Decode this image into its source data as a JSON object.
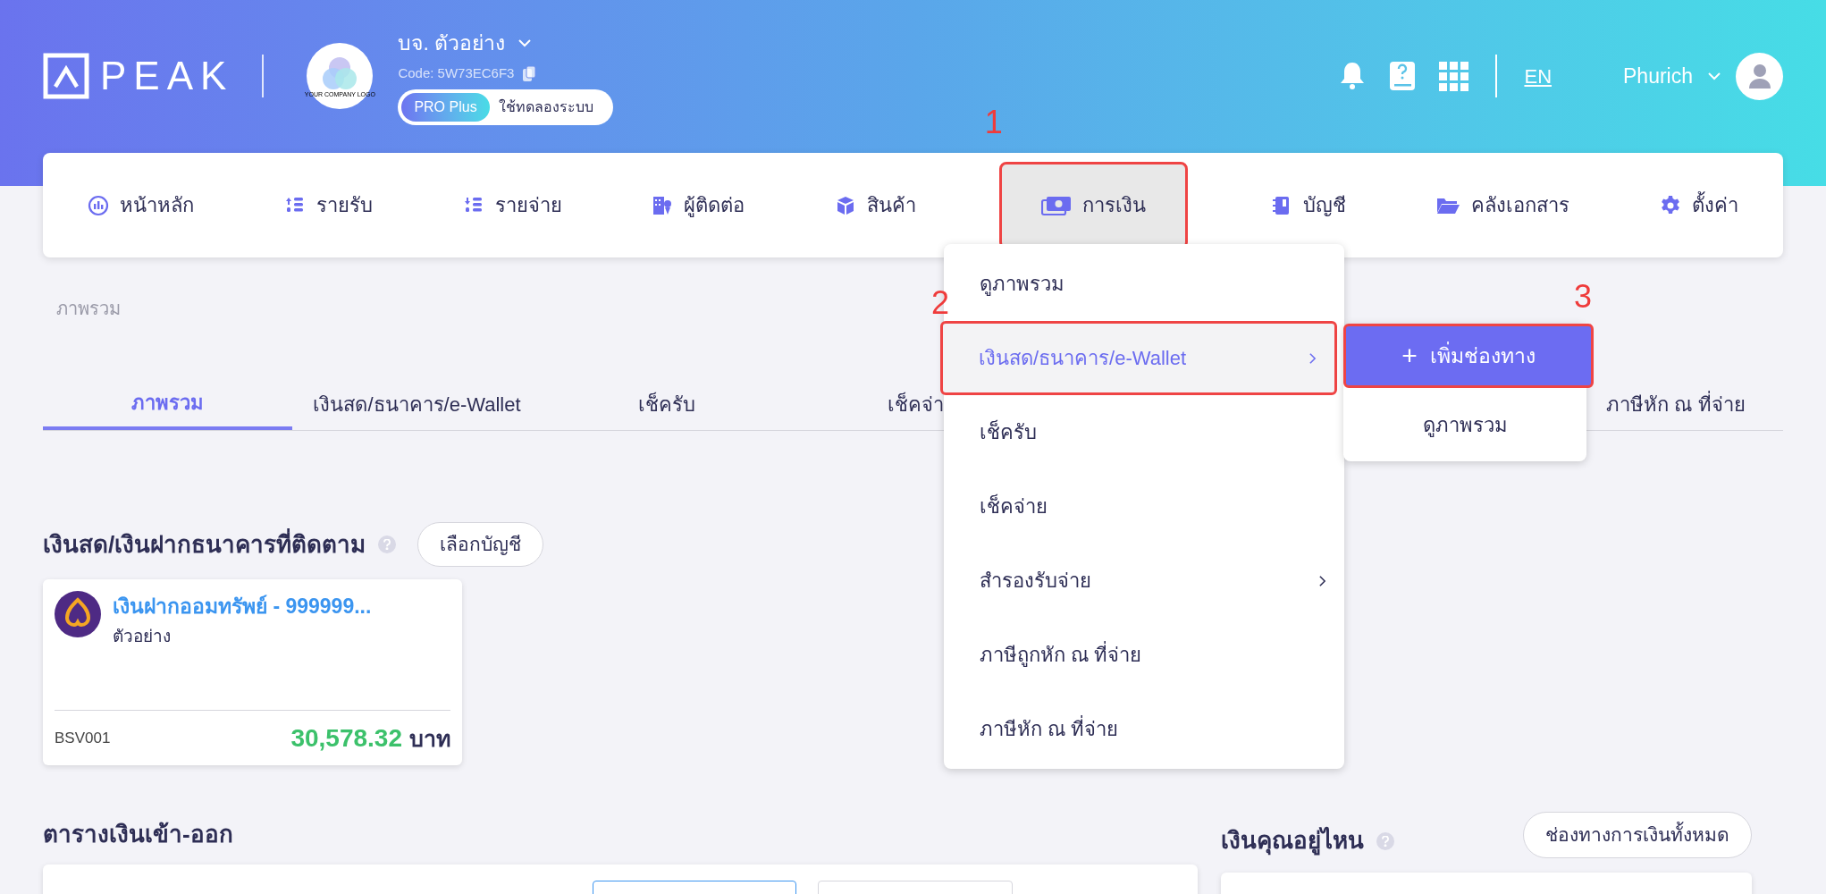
{
  "header": {
    "logo_text": "PEAK",
    "company_logo_text": "YOUR COMPANY LOGO",
    "company_name": "บจ. ตัวอย่าง",
    "company_code": "Code: 5W73EC6F3",
    "plan_badge": "PRO Plus",
    "plan_note": "ใช้ทดลองระบบ",
    "language": "EN",
    "user_name": "Phurich"
  },
  "nav": {
    "items": [
      {
        "label": "หน้าหลัก",
        "selected": false
      },
      {
        "label": "รายรับ",
        "selected": false
      },
      {
        "label": "รายจ่าย",
        "selected": false
      },
      {
        "label": "ผู้ติดต่อ",
        "selected": false
      },
      {
        "label": "สินค้า",
        "selected": false
      },
      {
        "label": "การเงิน",
        "selected": true,
        "callout": "1"
      },
      {
        "label": "บัญชี",
        "selected": false
      },
      {
        "label": "คลังเอกสาร",
        "selected": false
      },
      {
        "label": "ตั้งค่า",
        "selected": false
      }
    ]
  },
  "breadcrumb": "ภาพรวม",
  "tabs": [
    {
      "label": "ภาพรวม",
      "selected": true
    },
    {
      "label": "เงินสด/ธนาคาร/e-Wallet",
      "selected": false
    },
    {
      "label": "เช็ครับ",
      "selected": false
    },
    {
      "label": "เช็คจ่า",
      "selected": false
    },
    {
      "label": "ภาษีหัก ณ ที่จ่าย",
      "selected": false
    }
  ],
  "dropdown": {
    "items": [
      {
        "label": "ดูภาพรวม",
        "selected": false,
        "has_submenu": false
      },
      {
        "label": "เงินสด/ธนาคาร/e-Wallet",
        "selected": true,
        "has_submenu": true,
        "callout": "2"
      },
      {
        "label": "เช็ครับ",
        "selected": false,
        "has_submenu": false
      },
      {
        "label": "เช็คจ่าย",
        "selected": false,
        "has_submenu": false
      },
      {
        "label": "สำรองรับจ่าย",
        "selected": false,
        "has_submenu": true
      },
      {
        "label": "ภาษีถูกหัก ณ ที่จ่าย",
        "selected": false,
        "has_submenu": false
      },
      {
        "label": "ภาษีหัก ณ ที่จ่าย",
        "selected": false,
        "has_submenu": false
      }
    ]
  },
  "submenu": {
    "items": [
      {
        "kind": "primary",
        "icon": "+",
        "label": "เพิ่มช่องทาง",
        "callout": "3"
      },
      {
        "kind": "plain",
        "label": "ดูภาพรวม"
      }
    ]
  },
  "tracked": {
    "title": "เงินสด/เงินฝากธนาคารที่ติดตาม",
    "button": "เลือกบัญชี",
    "accounts": [
      {
        "name": "เงินฝากออมทรัพย์ - 999999...",
        "subtitle": "ตัวอย่าง",
        "code": "BSV001",
        "amount": "30,578.32",
        "currency": "บาท"
      }
    ]
  },
  "cashflow": {
    "title": "ตารางเงินเข้า-ออก"
  },
  "where": {
    "title": "เงินคุณอยู่ไหน",
    "button": "ช่องทางการเงินทั้งหมด"
  }
}
